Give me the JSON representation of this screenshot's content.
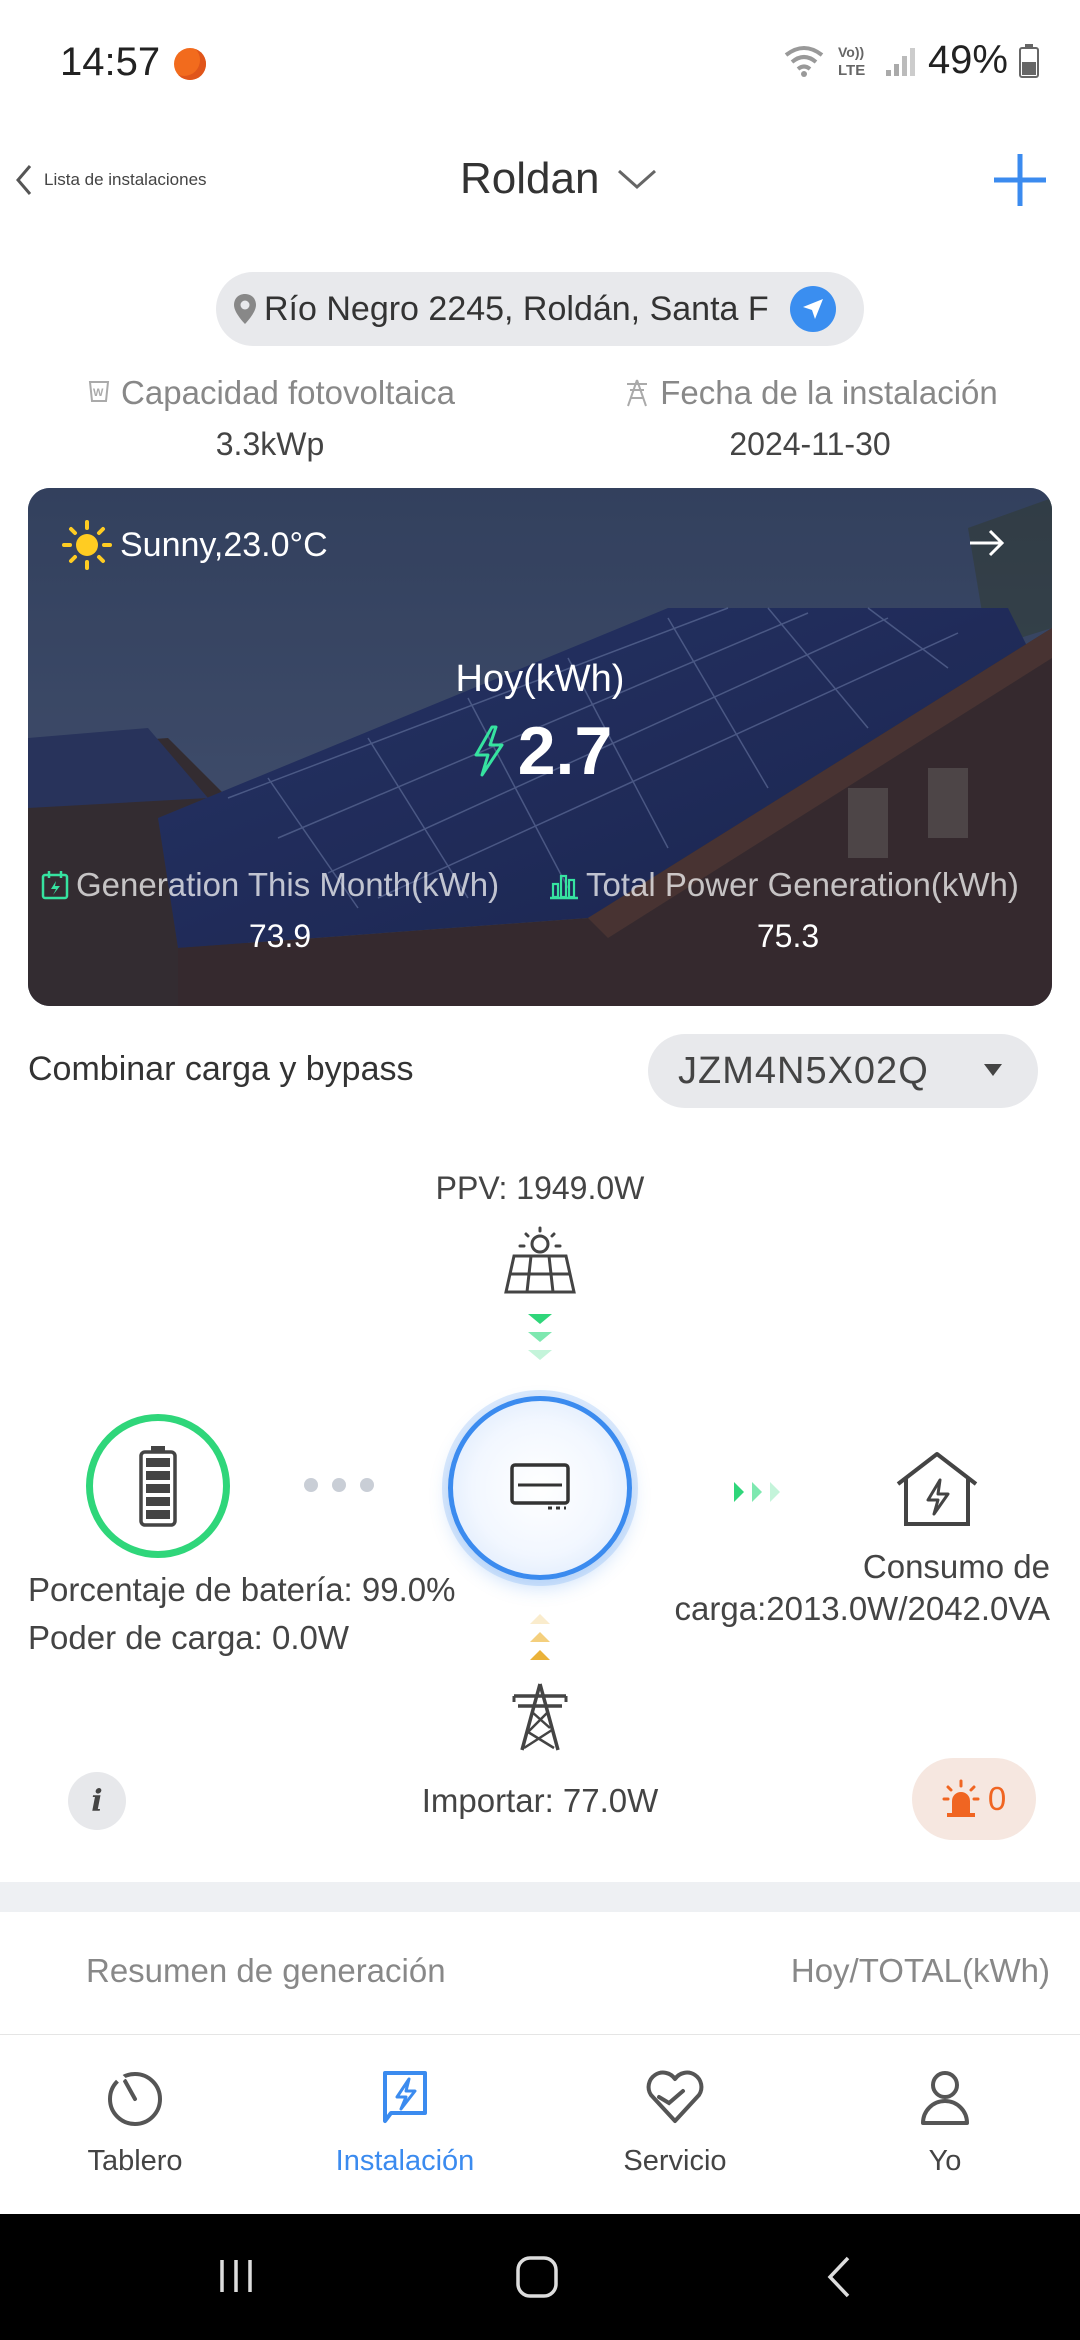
{
  "status_bar": {
    "time": "14:57",
    "battery": "49%"
  },
  "header": {
    "back_label": "Lista de instalaciones",
    "title": "Roldan"
  },
  "address": "Río Negro 2245, Roldán, Santa F",
  "info": {
    "capacity_label": "Capacidad fotovoltaica",
    "capacity_value": "3.3kWp",
    "install_date_label": "Fecha de la instalación",
    "install_date_value": "2024-11-30"
  },
  "hero": {
    "weather": "Sunny,23.0°C",
    "today_label": "Hoy(kWh)",
    "today_value": "2.7",
    "month_label": "Generation This Month(kWh)",
    "month_value": "73.9",
    "total_label": "Total Power Generation(kWh)",
    "total_value": "75.3"
  },
  "device": {
    "mode_label": "Combinar carga y bypass",
    "selected": "JZM4N5X02Q"
  },
  "flow": {
    "ppv": "PPV: 1949.0W",
    "battery_percent": "Porcentaje de batería: 99.0%",
    "charge_power": "Poder de carga: 0.0W",
    "load_line1": "Consumo de",
    "load_line2": "carga:2013.0W/2042.0VA",
    "import": "Importar: 77.0W",
    "alarm_count": "0",
    "battery_level": 0.99,
    "colors": {
      "battery_ring": "#2fd67a",
      "accent": "#3b8bef",
      "alarm": "#f06522"
    }
  },
  "summary": {
    "label": "Resumen de generación",
    "unit": "Hoy/TOTAL(kWh)"
  },
  "tabs": [
    {
      "label": "Tablero",
      "icon": "dashboard-gauge-icon"
    },
    {
      "label": "Instalación",
      "icon": "installation-lightning-icon",
      "active": true
    },
    {
      "label": "Servicio",
      "icon": "service-heart-icon"
    },
    {
      "label": "Yo",
      "icon": "user-profile-icon"
    }
  ]
}
